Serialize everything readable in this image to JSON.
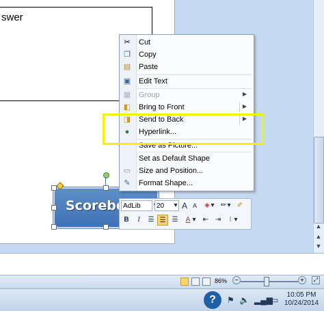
{
  "document": {
    "textbox_text": "swer",
    "shape_text": "Scorebo"
  },
  "context_menu": {
    "items": [
      {
        "label": "Cut",
        "icon": "scissors-icon",
        "enabled": true,
        "submenu": false
      },
      {
        "label": "Copy",
        "icon": "copy-icon",
        "enabled": true,
        "submenu": false
      },
      {
        "label": "Paste",
        "icon": "paste-icon",
        "enabled": true,
        "submenu": false
      },
      {
        "label": "Edit Text",
        "icon": "edit-text-icon",
        "enabled": true,
        "submenu": false
      },
      {
        "label": "Group",
        "icon": "group-icon",
        "enabled": false,
        "submenu": true
      },
      {
        "label": "Bring to Front",
        "icon": "bring-to-front-icon",
        "enabled": true,
        "submenu": true
      },
      {
        "label": "Send to Back",
        "icon": "send-to-back-icon",
        "enabled": true,
        "submenu": true
      },
      {
        "label": "Hyperlink...",
        "icon": "hyperlink-globe-icon",
        "enabled": true,
        "submenu": false
      },
      {
        "label": "Save as Picture...",
        "icon": "",
        "enabled": true,
        "submenu": false
      },
      {
        "label": "Set as Default Shape",
        "icon": "",
        "enabled": true,
        "submenu": false
      },
      {
        "label": "Size and Position...",
        "icon": "",
        "enabled": true,
        "submenu": false
      },
      {
        "label": "Format Shape...",
        "icon": "format-shape-icon",
        "enabled": true,
        "submenu": false
      }
    ]
  },
  "mini_toolbar": {
    "font_name": "AdLib",
    "font_size": "20",
    "grow_font": "A",
    "shrink_font": "A",
    "bold": "B",
    "italic": "I",
    "font_color_label": "A"
  },
  "status_bar": {
    "zoom": "86%",
    "zoom_out": "−",
    "zoom_in": "+"
  },
  "taskbar": {
    "time": "10:05 PM",
    "date": "10/24/2014"
  },
  "colors": {
    "highlight_box": "#f5f200",
    "shape_fill": "#4f81bd",
    "selected_button": "#ffd36b"
  }
}
